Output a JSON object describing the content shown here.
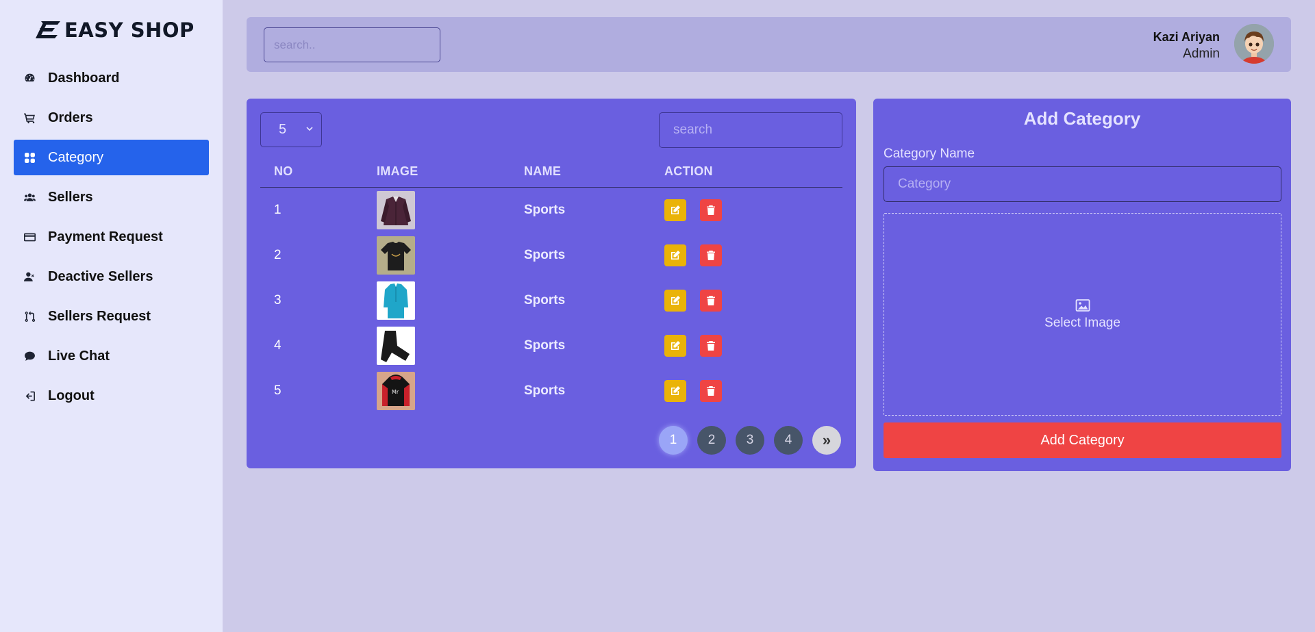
{
  "brand": {
    "name": "EASY SHOP"
  },
  "sidebar": {
    "items": [
      {
        "label": "Dashboard",
        "icon": "gauge-icon",
        "active": false
      },
      {
        "label": "Orders",
        "icon": "cart-icon",
        "active": false
      },
      {
        "label": "Category",
        "icon": "grid-icon",
        "active": true
      },
      {
        "label": "Sellers",
        "icon": "users-icon",
        "active": false
      },
      {
        "label": "Payment Request",
        "icon": "credit-card-icon",
        "active": false
      },
      {
        "label": "Deactive Sellers",
        "icon": "user-x-icon",
        "active": false
      },
      {
        "label": "Sellers Request",
        "icon": "git-pull-request-icon",
        "active": false
      },
      {
        "label": "Live Chat",
        "icon": "chat-icon",
        "active": false
      },
      {
        "label": "Logout",
        "icon": "logout-icon",
        "active": false
      }
    ]
  },
  "header": {
    "search_placeholder": "search..",
    "user_name": "Kazi Ariyan",
    "user_role": "Admin"
  },
  "table": {
    "per_page": "5",
    "search_placeholder": "search",
    "columns": [
      "NO",
      "IMAGE",
      "NAME",
      "ACTION"
    ],
    "rows": [
      {
        "no": "1",
        "image": "purple-shirt",
        "name": "Sports"
      },
      {
        "no": "2",
        "image": "black-tshirt",
        "name": "Sports"
      },
      {
        "no": "3",
        "image": "blue-kurta",
        "name": "Sports"
      },
      {
        "no": "4",
        "image": "black-pants",
        "name": "Sports"
      },
      {
        "no": "5",
        "image": "black-red-hoodie",
        "name": "Sports"
      }
    ],
    "pages": [
      "1",
      "2",
      "3",
      "4"
    ],
    "current_page": "1",
    "next_label": "»"
  },
  "add_category": {
    "title": "Add Category",
    "field_label": "Category Name",
    "input_placeholder": "Category",
    "dropzone_text": "Select Image",
    "submit_label": "Add Category"
  },
  "colors": {
    "sidebar_bg": "#e6e7fb",
    "page_bg": "#cdcae9",
    "panel_bg": "#6a5fe0",
    "active_nav": "#2563eb",
    "edit_button": "#eab308",
    "delete_button": "#ef4444"
  }
}
